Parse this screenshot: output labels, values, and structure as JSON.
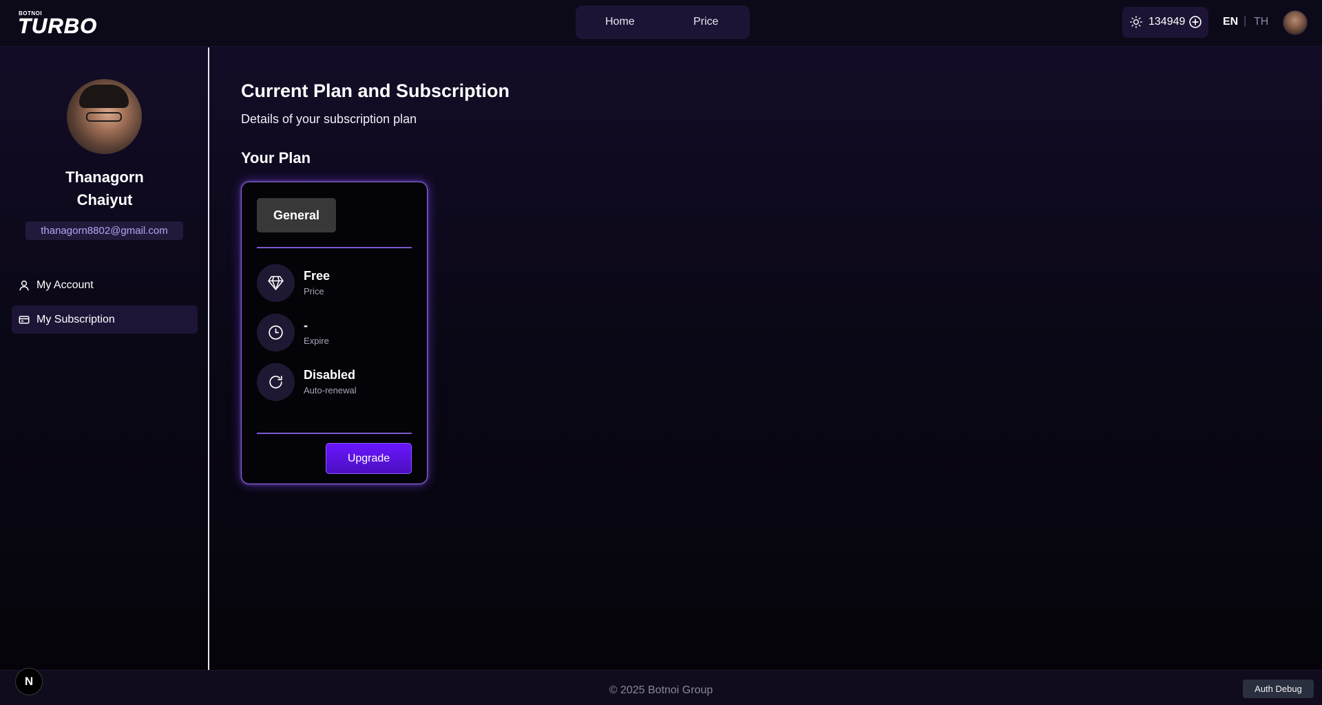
{
  "header": {
    "logo_top": "BOTNOI",
    "logo_main": "TURBO",
    "nav": {
      "home": "Home",
      "price": "Price"
    },
    "credits": "134949",
    "lang_en": "EN",
    "lang_sep": "|",
    "lang_th": "TH"
  },
  "sidebar": {
    "name": "Thanagorn Chaiyut",
    "email": "thanagorn8802@gmail.com",
    "menu": [
      {
        "label": "My Account",
        "icon": "user-icon"
      },
      {
        "label": "My Subscription",
        "icon": "credit-card-icon",
        "active": true
      }
    ]
  },
  "main": {
    "title": "Current Plan and Subscription",
    "subtitle": "Details of your subscription plan",
    "section_title": "Your Plan",
    "plan": {
      "tier": "General",
      "rows": [
        {
          "value": "Free",
          "label": "Price",
          "icon": "diamond-icon"
        },
        {
          "value": "-",
          "label": "Expire",
          "icon": "clock-icon"
        },
        {
          "value": "Disabled",
          "label": "Auto-renewal",
          "icon": "refresh-icon"
        }
      ],
      "upgrade_label": "Upgrade"
    }
  },
  "footer": {
    "copyright": "© 2025 Botnoi Group",
    "next_badge": "N",
    "auth_debug": "Auth Debug"
  },
  "colors": {
    "accent": "#6a16ff",
    "card_border": "#8f6ae0",
    "email_text": "#b9a3f5"
  }
}
